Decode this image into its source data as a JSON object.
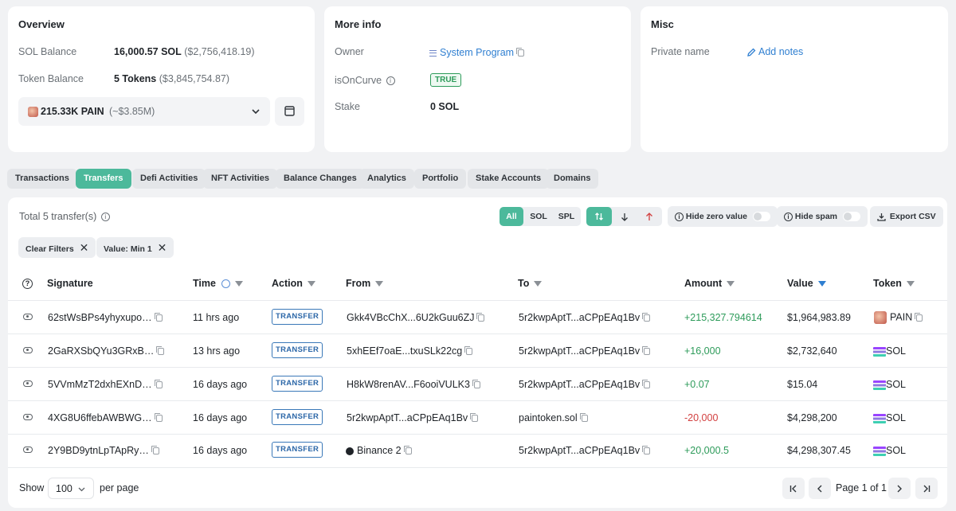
{
  "overview": {
    "title": "Overview",
    "sol_balance_label": "SOL Balance",
    "sol_balance_value": "16,000.57 SOL",
    "sol_balance_usd": "($2,756,418.19)",
    "token_balance_label": "Token Balance",
    "token_balance_value": "5 Tokens",
    "token_balance_usd": "($3,845,754.87)",
    "token_select_amount": "215.33K PAIN",
    "token_select_usd": "(~$3.85M)"
  },
  "more_info": {
    "title": "More info",
    "owner_label": "Owner",
    "owner_value": "System Program",
    "isoncurve_label": "isOnCurve",
    "isoncurve_value": "TRUE",
    "stake_label": "Stake",
    "stake_value": "0 SOL"
  },
  "misc": {
    "title": "Misc",
    "private_name_label": "Private name",
    "add_notes": "Add notes"
  },
  "tabs": [
    "Transactions",
    "Transfers",
    "Defi Activities",
    "NFT Activities",
    "Balance Changes",
    "Analytics",
    "Portfolio",
    "Stake Accounts",
    "Domains"
  ],
  "transfers": {
    "total": "Total 5 transfer(s)",
    "filter_all": "All",
    "filter_sol": "SOL",
    "filter_spl": "SPL",
    "hide_zero": "Hide zero value",
    "hide_spam": "Hide spam",
    "export": "Export CSV",
    "clear_filters": "Clear Filters",
    "value_filter": "Value: Min 1"
  },
  "table": {
    "headers": {
      "signature": "Signature",
      "time": "Time",
      "action": "Action",
      "from": "From",
      "to": "To",
      "amount": "Amount",
      "value": "Value",
      "token": "Token"
    },
    "rows": [
      {
        "signature": "62stWsBPs4yhyxupo…",
        "time": "11 hrs ago",
        "action": "TRANSFER",
        "from": "Gkk4VBcChX...6U2kGuu6ZJ",
        "to": "5r2kwpAptT...aCPpEAq1Bv",
        "amount": "+215,327.794614",
        "value": "$1,964,983.89",
        "token": "PAIN"
      },
      {
        "signature": "2GaRXSbQYu3GRxB…",
        "time": "13 hrs ago",
        "action": "TRANSFER",
        "from": "5xhEEf7oaE...txuSLk22cg",
        "to": "5r2kwpAptT...aCPpEAq1Bv",
        "amount": "+16,000",
        "value": "$2,732,640",
        "token": "SOL"
      },
      {
        "signature": "5VVmMzT2dxhEXnD…",
        "time": "16 days ago",
        "action": "TRANSFER",
        "from": "H8kW8renAV...F6ooiVULK3",
        "to": "5r2kwpAptT...aCPpEAq1Bv",
        "amount": "+0.07",
        "value": "$15.04",
        "token": "SOL"
      },
      {
        "signature": "4XG8U6ffebAWBWG…",
        "time": "16 days ago",
        "action": "TRANSFER",
        "from": "5r2kwpAptT...aCPpEAq1Bv",
        "to": "paintoken.sol",
        "amount": "-20,000",
        "value": "$4,298,200",
        "token": "SOL"
      },
      {
        "signature": "2Y9BD9ytnLpTApRy…",
        "time": "16 days ago",
        "action": "TRANSFER",
        "from": "Binance 2",
        "to": "5r2kwpAptT...aCPpEAq1Bv",
        "amount": "+20,000.5",
        "value": "$4,298,307.45",
        "token": "SOL"
      }
    ]
  },
  "pagination": {
    "show": "Show",
    "page_size": "100",
    "per_page": "per page",
    "page_label": "Page 1 of 1"
  }
}
